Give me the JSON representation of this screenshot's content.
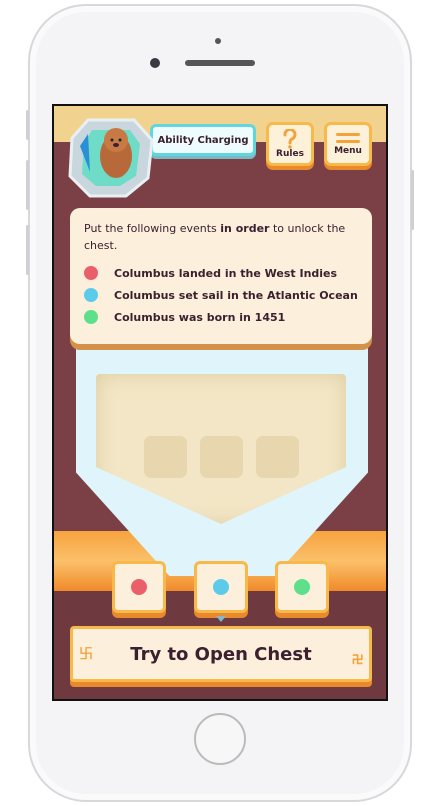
{
  "header": {
    "ability_label": "Ability Charging",
    "rules_label": "Rules",
    "menu_label": "Menu"
  },
  "card": {
    "instruction_pre": "Put the following events ",
    "instruction_bold": "in order",
    "instruction_post": " to unlock the chest.",
    "events": [
      {
        "label": "Columbus landed in the West Indies",
        "color": "#e9606b"
      },
      {
        "label": "Columbus set sail in the Atlantic Ocean",
        "color": "#5ccbea"
      },
      {
        "label": "Columbus was born in 1451",
        "color": "#5ee08a"
      }
    ]
  },
  "tiles": [
    {
      "color": "#e9606b"
    },
    {
      "color": "#5ccbea"
    },
    {
      "color": "#5ee08a"
    }
  ],
  "action": {
    "label": "Try to Open Chest"
  },
  "colors": {
    "accent": "#f7b94a",
    "background": "#7b4046",
    "card": "#fcf0dc"
  }
}
